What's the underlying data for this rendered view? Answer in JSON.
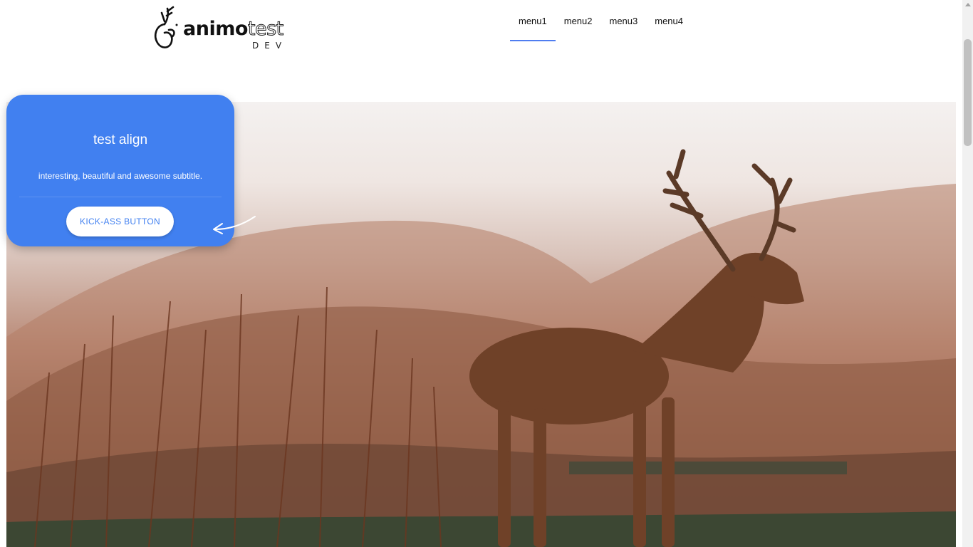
{
  "logo": {
    "brand_bold": "animo",
    "brand_outline": "test",
    "sub": "DEV"
  },
  "nav": {
    "items": [
      {
        "label": "menu1",
        "active": true
      },
      {
        "label": "menu2",
        "active": false
      },
      {
        "label": "menu3",
        "active": false
      },
      {
        "label": "menu4",
        "active": false
      }
    ]
  },
  "card": {
    "title": "test align",
    "subtitle": "interesting, beautiful and awesome subtitle.",
    "button_label": "KICK-ASS BUTTON"
  },
  "colors": {
    "accent": "#4180f0",
    "nav_indicator": "#4f7df0"
  },
  "icons": {
    "logo": "deer-antler-icon",
    "arrow": "curved-arrow-left-icon"
  }
}
